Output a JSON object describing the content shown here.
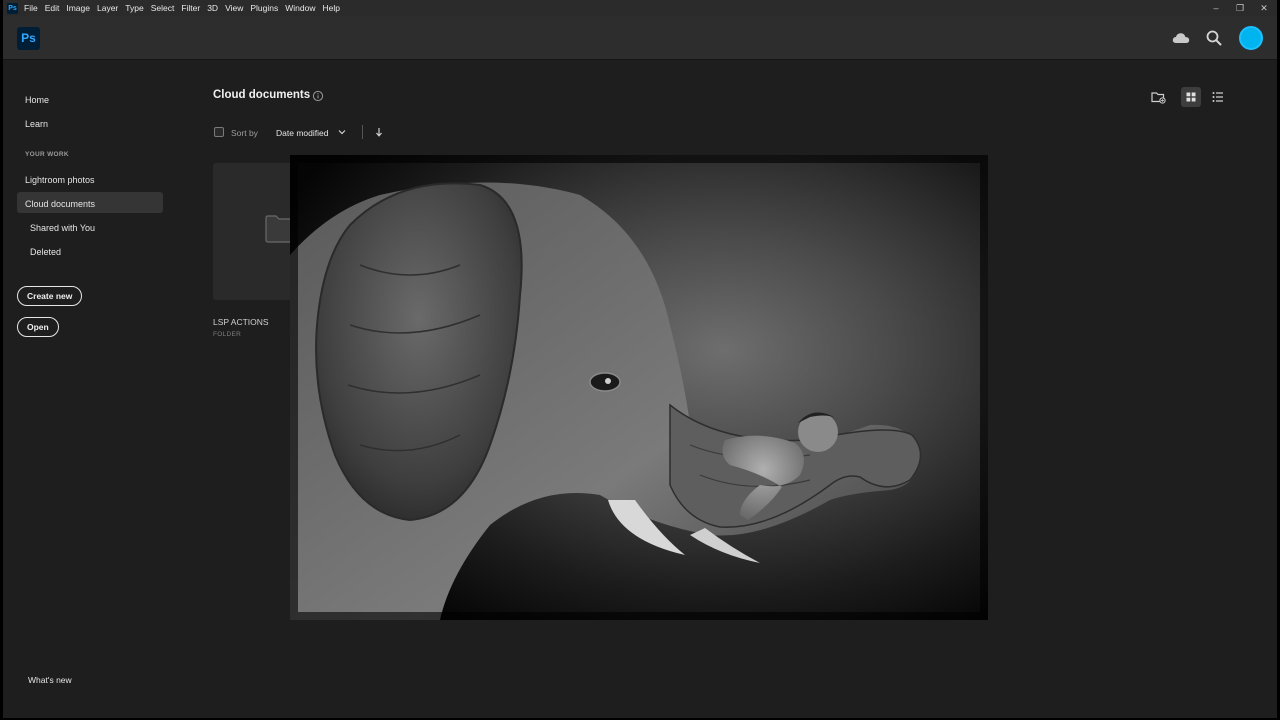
{
  "menubar": {
    "app_badge": "Ps",
    "items": [
      "File",
      "Edit",
      "Image",
      "Layer",
      "Type",
      "Select",
      "Filter",
      "3D",
      "View",
      "Plugins",
      "Window",
      "Help"
    ],
    "window_controls": [
      "–",
      "❐",
      "✕"
    ]
  },
  "appbar": {
    "logo": "Ps",
    "icons": [
      "cloud-icon",
      "search-icon",
      "avatar"
    ],
    "accent": "#31a8ff",
    "avatar_color": "#00b4f0"
  },
  "sidebar": {
    "home": "Home",
    "learn": "Learn",
    "section_label": "YOUR WORK",
    "lightroom": "Lightroom photos",
    "cloud_docs": "Cloud documents",
    "shared": "Shared with You",
    "deleted": "Deleted",
    "create_new": "Create new",
    "open": "Open",
    "whats_new": "What's new"
  },
  "main": {
    "title": "Cloud documents",
    "sort_label": "Sort by",
    "sort_value": "Date modified",
    "folder": {
      "name": "LSP ACTIONS",
      "type": "FOLDER"
    },
    "view_icons": [
      "new-folder-icon",
      "grid-view-icon",
      "list-view-icon"
    ]
  }
}
